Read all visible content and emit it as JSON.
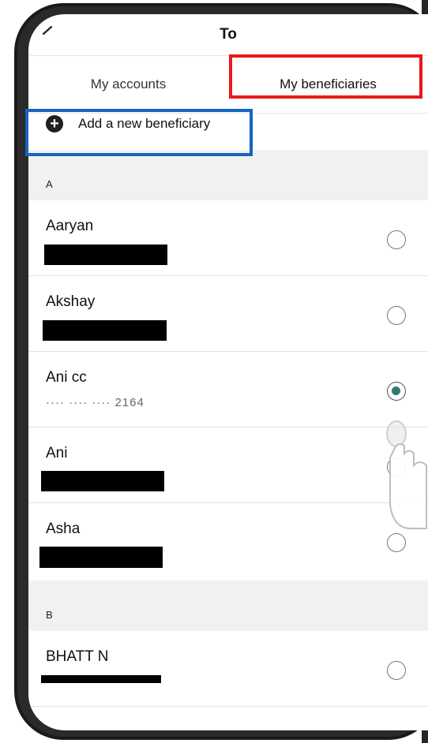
{
  "header": {
    "title": "To",
    "back_icon": "chevron-left-icon"
  },
  "tabs": [
    {
      "label": "My accounts",
      "selected": false
    },
    {
      "label": "My beneficiaries",
      "selected": true
    }
  ],
  "add_beneficiary": {
    "label": "Add a new beneficiary",
    "icon": "plus-circle-icon"
  },
  "sections": [
    {
      "letter": "A",
      "items": [
        {
          "name": "Aaryan",
          "selected": false,
          "account_redacted": true
        },
        {
          "name": "Akshay",
          "selected": false,
          "account_redacted": true
        },
        {
          "name": "Ani cc",
          "account": "···· ···· ···· 2164",
          "selected": true
        },
        {
          "name": "Ani",
          "selected": false,
          "account_redacted": true
        },
        {
          "name": "Asha",
          "selected": false,
          "account_redacted": true
        }
      ]
    },
    {
      "letter": "B",
      "items": [
        {
          "name": "BHATT N",
          "selected": false,
          "account_redacted": true
        }
      ]
    }
  ],
  "highlights": {
    "red": "#e81919",
    "blue": "#1565c0"
  },
  "accent": "#2f7b70"
}
